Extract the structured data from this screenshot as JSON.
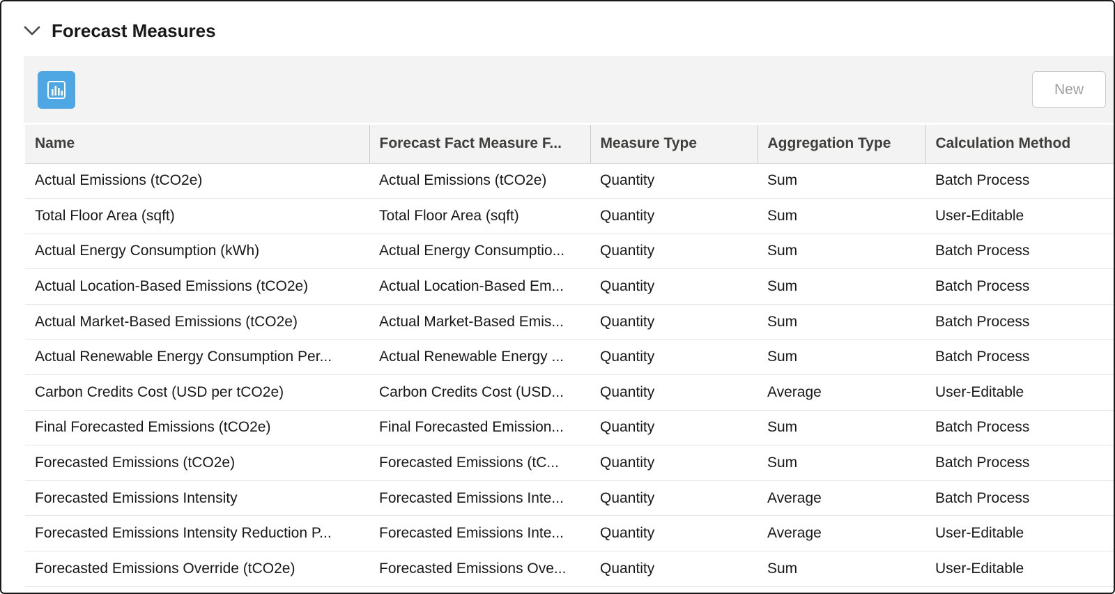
{
  "section": {
    "title": "Forecast Measures",
    "collapse_icon": "chevron-down-icon"
  },
  "toolbar": {
    "list_icon": "bar-chart-icon",
    "list_icon_color": "#4ea7e3",
    "new_label": "New"
  },
  "table": {
    "columns": [
      "Name",
      "Forecast Fact Measure F...",
      "Measure Type",
      "Aggregation Type",
      "Calculation Method"
    ],
    "rows": [
      [
        "Actual Emissions (tCO2e)",
        "Actual Emissions (tCO2e)",
        "Quantity",
        "Sum",
        "Batch Process"
      ],
      [
        "Total Floor Area (sqft)",
        "Total Floor Area (sqft)",
        "Quantity",
        "Sum",
        "User-Editable"
      ],
      [
        "Actual Energy Consumption (kWh)",
        "Actual Energy Consumptio...",
        "Quantity",
        "Sum",
        "Batch Process"
      ],
      [
        "Actual Location-Based Emissions (tCO2e)",
        "Actual Location-Based Em...",
        "Quantity",
        "Sum",
        "Batch Process"
      ],
      [
        "Actual Market-Based Emissions (tCO2e)",
        "Actual Market-Based Emis...",
        "Quantity",
        "Sum",
        "Batch Process"
      ],
      [
        "Actual Renewable Energy Consumption Per...",
        "Actual Renewable Energy ...",
        "Quantity",
        "Sum",
        "Batch Process"
      ],
      [
        "Carbon Credits Cost (USD per tCO2e)",
        "Carbon Credits Cost (USD...",
        "Quantity",
        "Average",
        "User-Editable"
      ],
      [
        "Final Forecasted Emissions (tCO2e)",
        "Final Forecasted Emission...",
        "Quantity",
        "Sum",
        "Batch Process"
      ],
      [
        "Forecasted Emissions (tCO2e)",
        "Forecasted Emissions (tC...",
        "Quantity",
        "Sum",
        "Batch Process"
      ],
      [
        "Forecasted Emissions Intensity",
        "Forecasted Emissions Inte...",
        "Quantity",
        "Average",
        "Batch Process"
      ],
      [
        "Forecasted Emissions Intensity Reduction P...",
        "Forecasted Emissions Inte...",
        "Quantity",
        "Average",
        "User-Editable"
      ],
      [
        "Forecasted Emissions Override (tCO2e)",
        "Forecasted Emissions Ove...",
        "Quantity",
        "Sum",
        "User-Editable"
      ]
    ]
  }
}
